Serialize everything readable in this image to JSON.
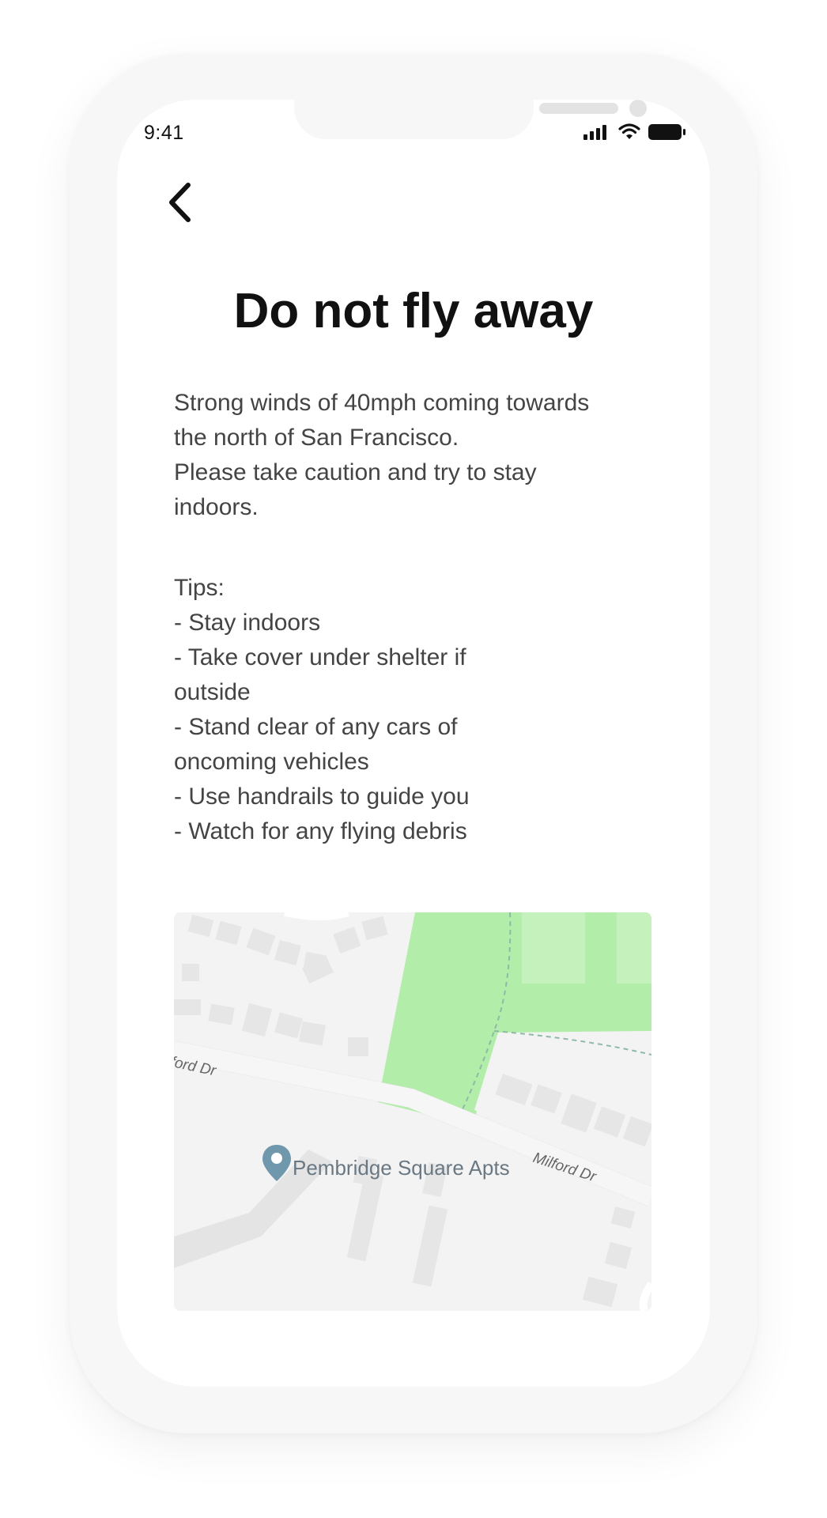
{
  "status_bar": {
    "time": "9:41",
    "icons": [
      "signal-icon",
      "wifi-icon",
      "battery-icon"
    ]
  },
  "header": {
    "back_icon": "chevron-left-icon"
  },
  "alert": {
    "title": "Do not fly away",
    "description": "Strong winds of 40mph coming towards\nthe north of San Francisco.\nPlease take caution and try to stay\nindoors.",
    "tips": "Tips:\n- Stay indoors\n- Take cover under shelter if\noutside\n- Stand clear of any cars of\noncoming vehicles\n- Use handrails to guide you\n- Watch for any flying debris"
  },
  "map": {
    "place_name": "Pembridge Square Apts",
    "street_left": "lford Dr",
    "street_right": "Milford Dr",
    "pin_icon": "location-pin-icon",
    "colors": {
      "park": "#b3edaa",
      "land": "#f3f3f3",
      "building": "#e8e8e8",
      "road": "#ffffff",
      "pin": "#6f98ad"
    }
  }
}
